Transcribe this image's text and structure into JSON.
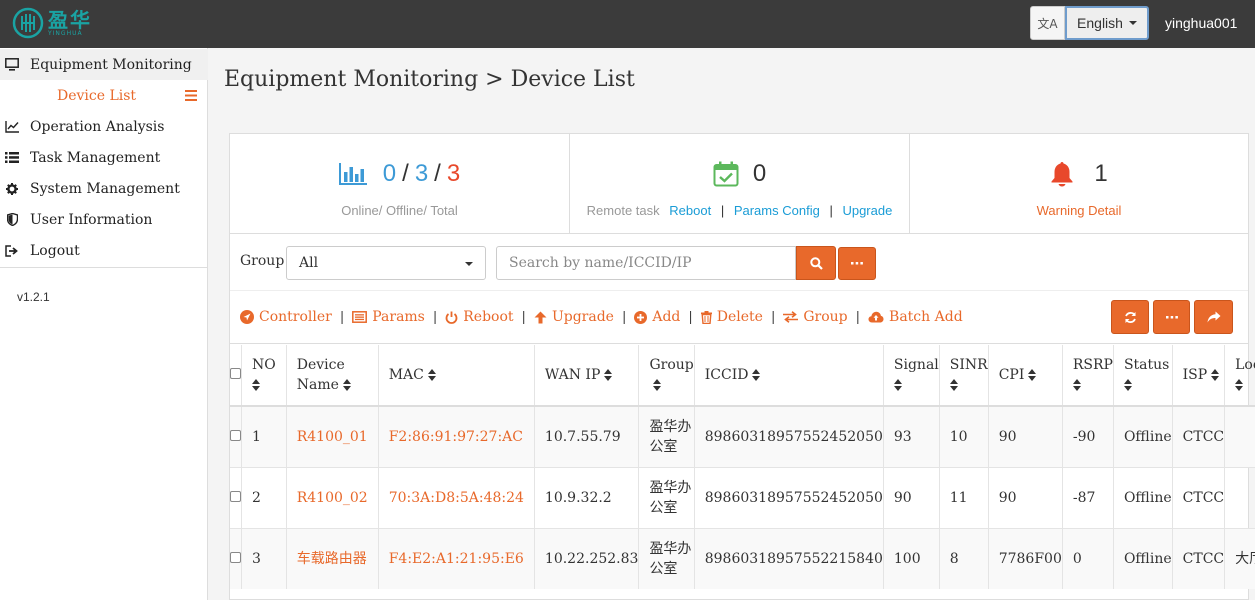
{
  "header": {
    "logo_cn": "盈华",
    "logo_en": "YINGHUA",
    "translate_icon_text": "文A",
    "language": "English",
    "username": "yinghua001"
  },
  "sidebar": {
    "items": [
      {
        "label": "Equipment Monitoring",
        "icon": "monitor-icon"
      },
      {
        "label": "Operation Analysis",
        "icon": "line-chart-icon"
      },
      {
        "label": "Task Management",
        "icon": "list-icon"
      },
      {
        "label": "System Management",
        "icon": "gear-icon"
      },
      {
        "label": "User Information",
        "icon": "shield-icon"
      },
      {
        "label": "Logout",
        "icon": "logout-icon"
      }
    ],
    "sub_item": "Device List",
    "version": "v1.2.1"
  },
  "page": {
    "title": "Equipment Monitoring > Device List"
  },
  "stats": {
    "online": "0",
    "offline": "3",
    "total": "3",
    "slash": "/",
    "online_label": "Online/ Offline/ Total",
    "remote_count": "0",
    "remote_label": "Remote task",
    "reboot_link": "Reboot",
    "params_link": "Params Config",
    "upgrade_link": "Upgrade",
    "link_sep": "|",
    "warning_count": "1",
    "warning_link": "Warning Detail"
  },
  "filter": {
    "group_label": "Group",
    "group_value": "All",
    "search_placeholder": "Search by name/ICCID/IP"
  },
  "toolbar": {
    "actions": [
      "Controller",
      "Params",
      "Reboot",
      "Upgrade",
      "Add",
      "Delete",
      "Group",
      "Batch Add"
    ],
    "sep": "|"
  },
  "table": {
    "headers": [
      "NO",
      "Device Name",
      "MAC",
      "WAN IP",
      "Group",
      "ICCID",
      "Signal",
      "SINR",
      "CPI",
      "RSRP",
      "Status",
      "ISP",
      "Location"
    ],
    "rows": [
      {
        "no": "1",
        "name": "R4100_01",
        "mac": "F2:86:91:97:27:AC",
        "wan_ip": "10.7.55.79",
        "group": "盈华办公室",
        "iccid": "89860318957552452050",
        "signal": "93",
        "sinr": "10",
        "cpi": "90",
        "rsrp": "-90",
        "status": "Offline",
        "isp": "CTCC",
        "location": ""
      },
      {
        "no": "2",
        "name": "R4100_02",
        "mac": "70:3A:D8:5A:48:24",
        "wan_ip": "10.9.32.2",
        "group": "盈华办公室",
        "iccid": "89860318957552452050",
        "signal": "90",
        "sinr": "11",
        "cpi": "90",
        "rsrp": "-87",
        "status": "Offline",
        "isp": "CTCC",
        "location": ""
      },
      {
        "no": "3",
        "name": "车载路由器",
        "mac": "F4:E2:A1:21:95:E6",
        "wan_ip": "10.22.252.83",
        "group": "盈华办公室",
        "iccid": "89860318957552215840",
        "signal": "100",
        "sinr": "8",
        "cpi": "7786F00",
        "rsrp": "0",
        "status": "Offline",
        "isp": "CTCC",
        "location": "大厅"
      }
    ]
  },
  "colors": {
    "accent": "#e8692b",
    "link": "#1a9cd6",
    "topbar": "#3b3b3b",
    "online": "#3d9ad6",
    "total": "#e8482b",
    "warning": "#e8482b",
    "task_icon": "#5cb85c"
  }
}
